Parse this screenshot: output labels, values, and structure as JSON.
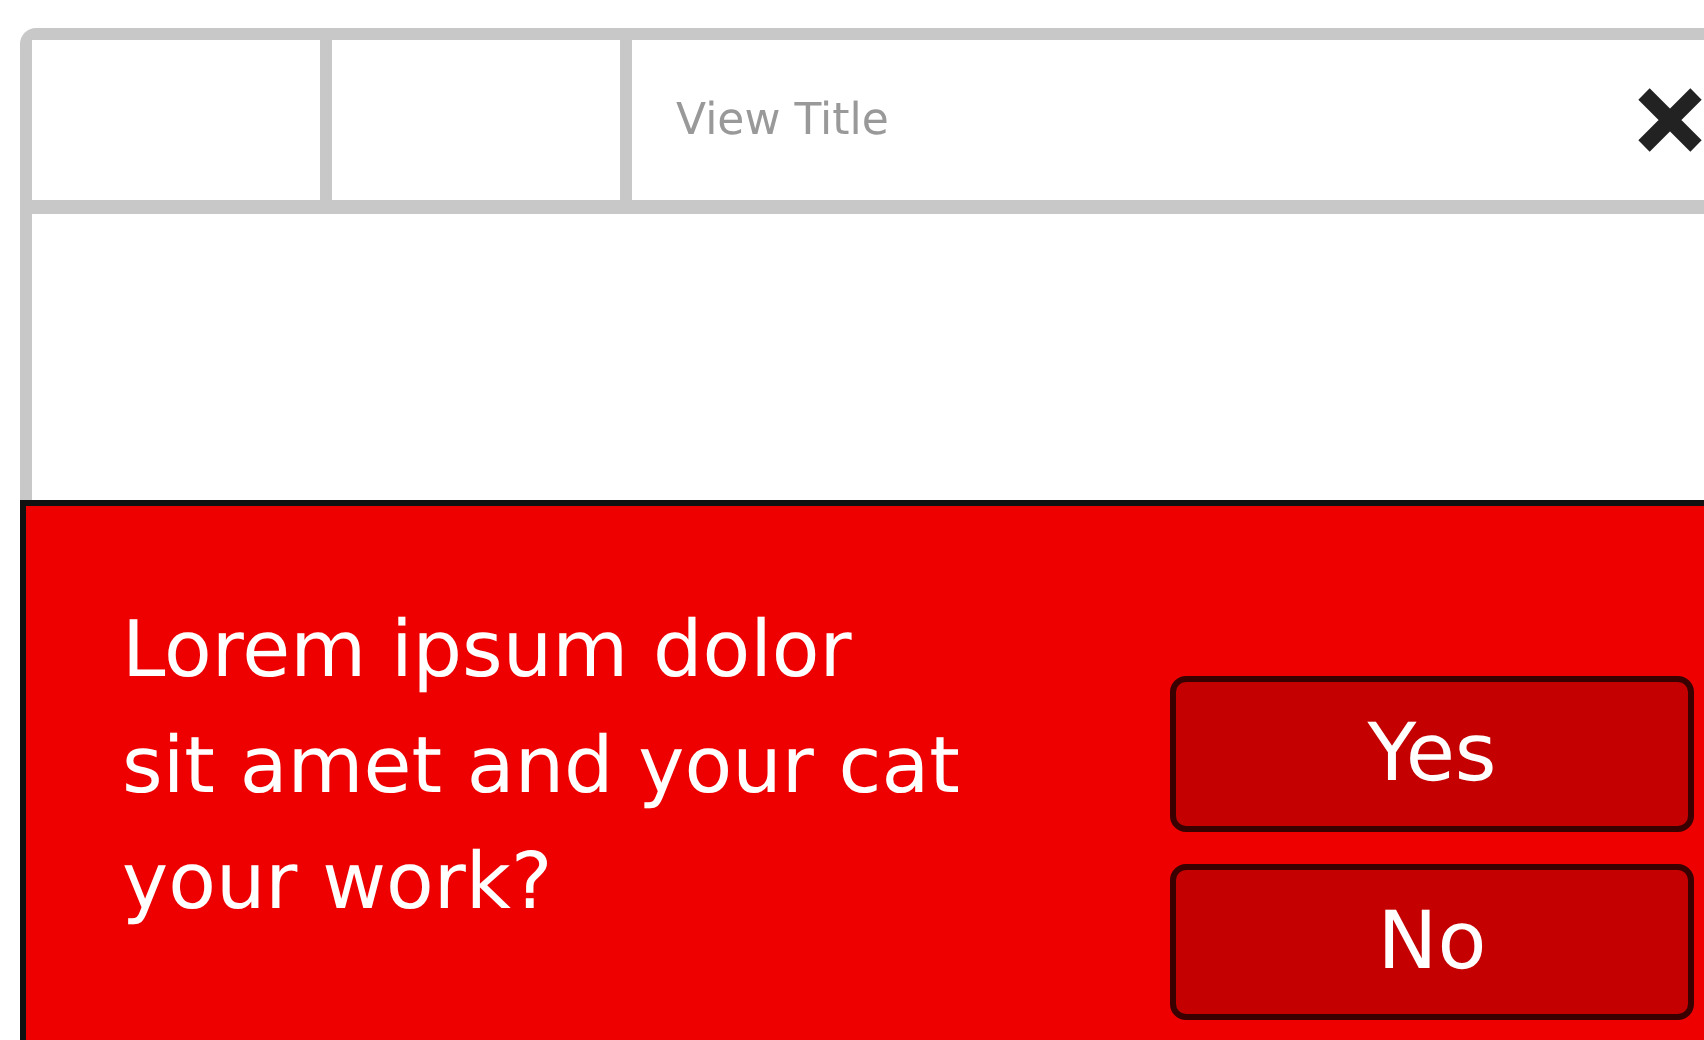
{
  "window": {
    "title": "View Title"
  },
  "dialog": {
    "message_lines": [
      "Lorem ipsum dolor",
      "sit amet and your cat",
      "your work?"
    ],
    "buttons": [
      "Yes",
      "No"
    ]
  }
}
